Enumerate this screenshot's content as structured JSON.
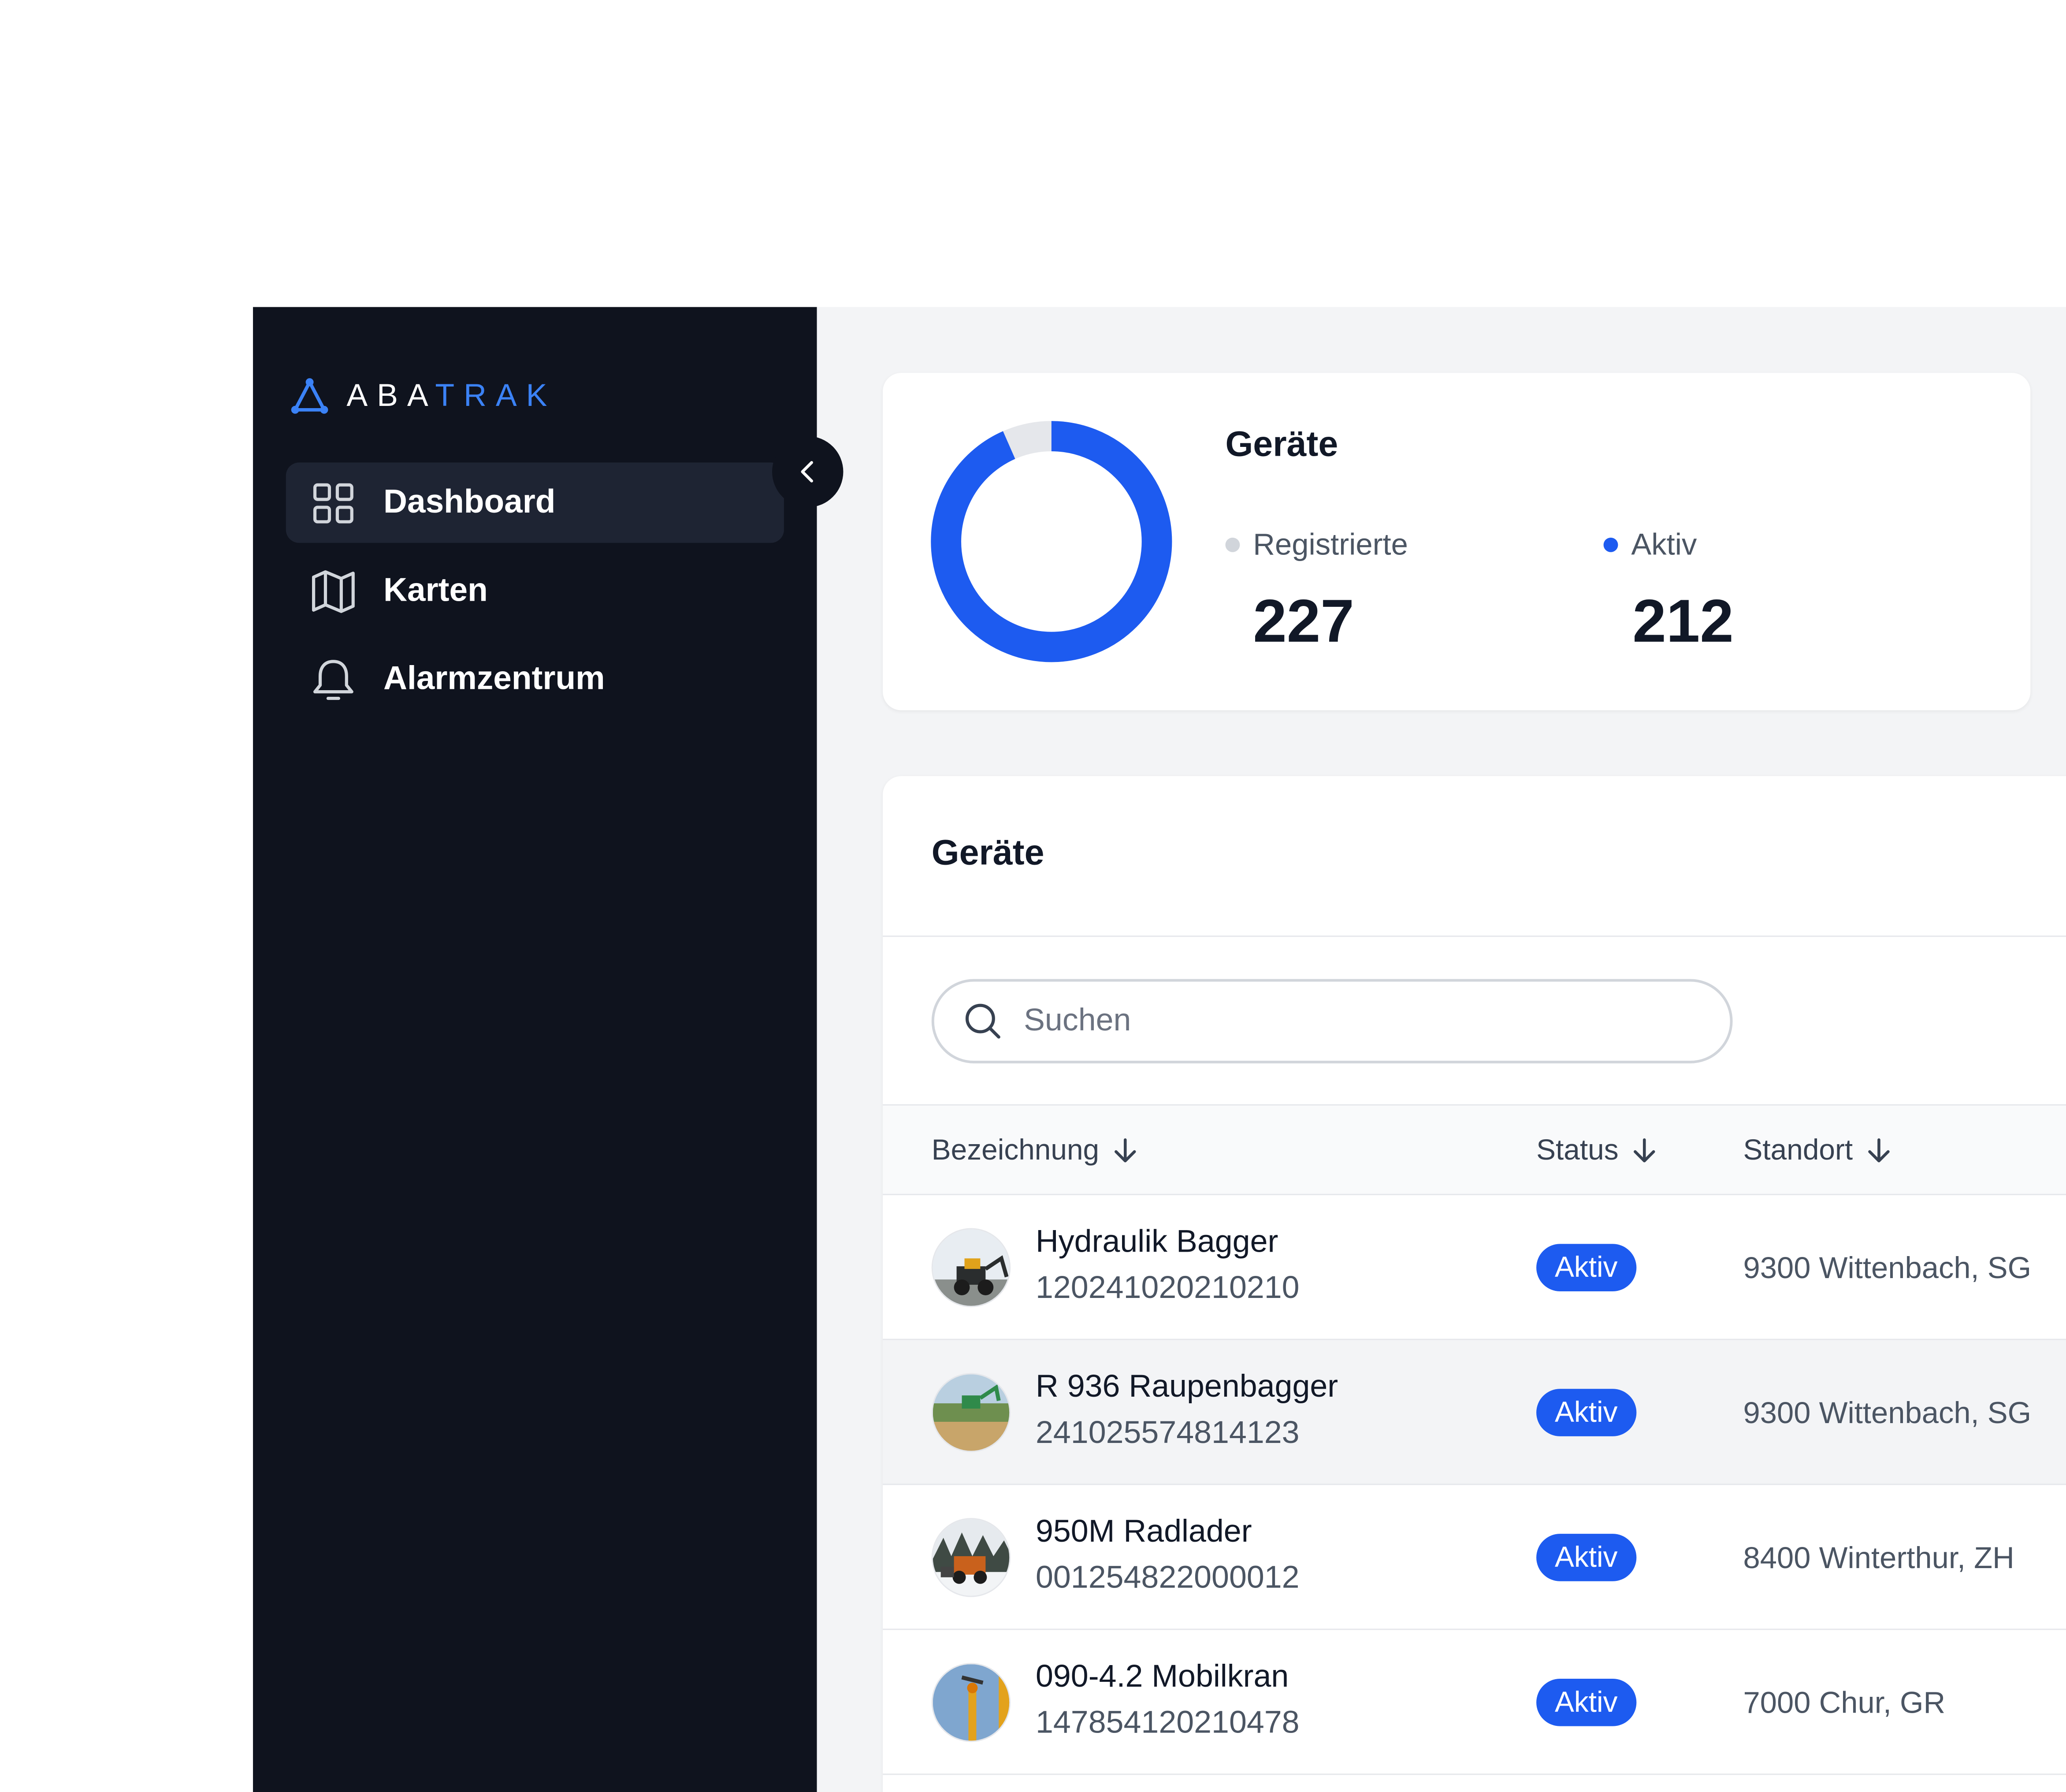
{
  "app": {
    "logo_prefix": "ABA",
    "logo_suffix": "TRAK",
    "brand_color": "#3b82f6"
  },
  "sidebar": {
    "items": [
      {
        "label": "Dashboard",
        "icon": "grid-icon",
        "active": true
      },
      {
        "label": "Karten",
        "icon": "map-icon",
        "active": false
      },
      {
        "label": "Alarmzentrum",
        "icon": "bell-icon",
        "active": false
      }
    ]
  },
  "stats": {
    "title": "Geräte",
    "registered_label": "Registrierte",
    "registered_value": "227",
    "active_label": "Aktiv",
    "active_value": "212",
    "active_fraction": 0.934,
    "active_color": "#1d5bf0",
    "registered_color": "#e5e7eb"
  },
  "devices": {
    "title": "Geräte",
    "search_placeholder": "Suchen",
    "columns": {
      "name": "Bezeichnung",
      "status": "Status",
      "location": "Standort"
    },
    "rows": [
      {
        "name": "Hydraulik Bagger",
        "id": "120241020210210",
        "status": "Aktiv",
        "location": "9300 Wittenbach, SG"
      },
      {
        "name": "R 936 Raupenbagger",
        "id": "241025574814123",
        "status": "Aktiv",
        "location": "9300 Wittenbach, SG"
      },
      {
        "name": "950M Radlader",
        "id": "001254822000012",
        "status": "Aktiv",
        "location": "8400 Winterthur, ZH"
      },
      {
        "name": "090-4.2 Mobilkran",
        "id": "147854120210478",
        "status": "Aktiv",
        "location": "7000 Chur, GR"
      }
    ]
  }
}
